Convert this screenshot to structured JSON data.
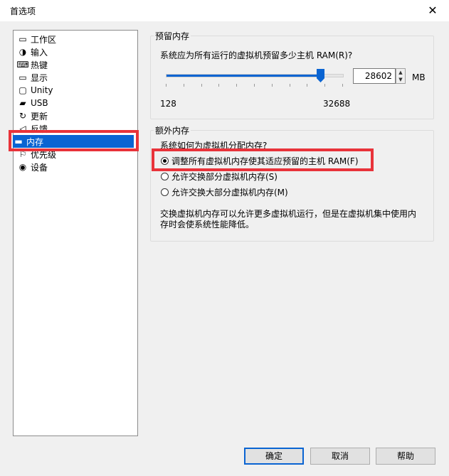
{
  "window": {
    "title": "首选项"
  },
  "sidebar": {
    "items": [
      {
        "label": "工作区",
        "icon": "workspace-icon"
      },
      {
        "label": "输入",
        "icon": "mouse-icon"
      },
      {
        "label": "热键",
        "icon": "keyboard-icon"
      },
      {
        "label": "显示",
        "icon": "monitor-icon"
      },
      {
        "label": "Unity",
        "icon": "unity-icon"
      },
      {
        "label": "USB",
        "icon": "usb-icon"
      },
      {
        "label": "更新",
        "icon": "refresh-icon"
      },
      {
        "label": "反馈",
        "icon": "feedback-icon"
      },
      {
        "label": "内存",
        "icon": "memory-icon",
        "selected": true
      },
      {
        "label": "优先级",
        "icon": "priority-icon"
      },
      {
        "label": "设备",
        "icon": "device-icon"
      }
    ]
  },
  "reserved": {
    "legend": "预留内存",
    "question": "系统应为所有运行的虚拟机预留多少主机 RAM(R)?",
    "value": "28602",
    "unit": "MB",
    "min_label": "128",
    "max_label": "32688",
    "min": 128,
    "max": 32688,
    "current": 28602
  },
  "extra": {
    "legend": "额外内存",
    "question": "系统如何为虚拟机分配内存?",
    "options": [
      {
        "label": "调整所有虚拟机内存使其适应预留的主机 RAM(F)",
        "selected": true
      },
      {
        "label": "允许交换部分虚拟机内存(S)",
        "selected": false
      },
      {
        "label": "允许交换大部分虚拟机内存(M)",
        "selected": false
      }
    ],
    "note_line1": "交换虚拟机内存可以允许更多虚拟机运行，但是在虚拟机集中使用内",
    "note_line2": "存时会使系统性能降低。"
  },
  "buttons": {
    "ok": "确定",
    "cancel": "取消",
    "help": "帮助"
  },
  "highlight_color": "#e8333a",
  "accent_color": "#0a64d2"
}
